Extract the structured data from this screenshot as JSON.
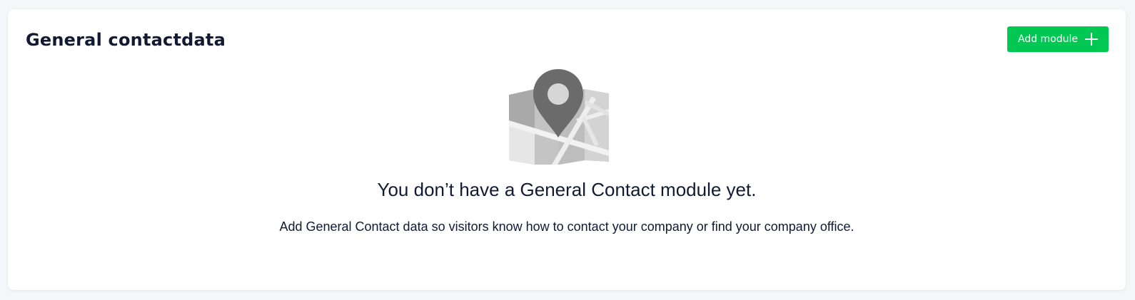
{
  "card": {
    "title": "General contactdata",
    "add_button": {
      "label": "Add module",
      "icon": "plus-icon",
      "color": "#00c853"
    }
  },
  "empty_state": {
    "illustration": "map-pin-icon",
    "title": "You don’t have a General Contact module yet.",
    "description": "Add General Contact data so visitors know how to contact your company or find your company office."
  }
}
